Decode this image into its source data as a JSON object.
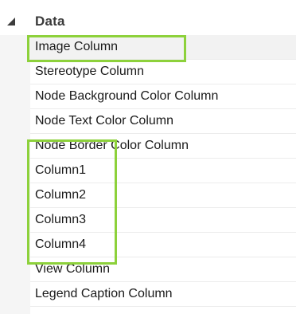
{
  "property_grid": {
    "category": {
      "label": "Data",
      "expanded": true,
      "expander_icon": "triangle-down-right-icon"
    },
    "properties": [
      {
        "label": "Image Column",
        "selected": true,
        "highlighted": true
      },
      {
        "label": "Stereotype Column",
        "selected": false,
        "highlighted": false
      },
      {
        "label": "Node Background Color Column",
        "selected": false,
        "highlighted": false
      },
      {
        "label": "Node Text Color Column",
        "selected": false,
        "highlighted": false
      },
      {
        "label": "Node Border Color Column",
        "selected": false,
        "highlighted": false
      },
      {
        "label": "Column1",
        "selected": false,
        "highlighted": true
      },
      {
        "label": "Column2",
        "selected": false,
        "highlighted": true
      },
      {
        "label": "Column3",
        "selected": false,
        "highlighted": true
      },
      {
        "label": "Column4",
        "selected": false,
        "highlighted": true
      },
      {
        "label": "View Column",
        "selected": false,
        "highlighted": false
      },
      {
        "label": "Legend Caption Column",
        "selected": false,
        "highlighted": false
      }
    ],
    "highlight_color": "#8dd13b",
    "selection_color": "#f2f2f2"
  }
}
